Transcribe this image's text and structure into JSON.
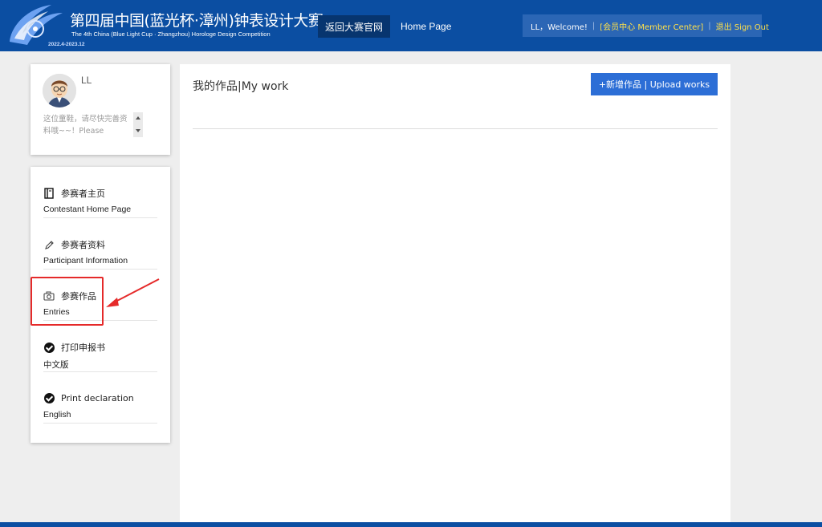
{
  "header": {
    "logo_title": "第四届中国(蓝光杯·漳州)钟表设计大赛",
    "logo_subtitle": "The 4th China (Blue Light Cup · Zhangzhou) Horologe Design Competition",
    "logo_date": "2022.4-2023.12",
    "nav_back": "返回大赛官网",
    "nav_home": "Home Page",
    "user_welcome": "LL，Welcome!",
    "member_center": "[会员中心 Member Center]",
    "sign_out": "退出 Sign Out"
  },
  "profile": {
    "name": "LL",
    "message": "这位童鞋，请尽快完善资料哦~~！Please"
  },
  "menu": {
    "items": [
      {
        "icon": "book-icon",
        "zh": "参赛者主页",
        "en": "Contestant Home Page"
      },
      {
        "icon": "pencil-icon",
        "zh": "参赛者资料",
        "en": "Participant Information"
      },
      {
        "icon": "camera-icon",
        "zh": "参赛作品",
        "en": "Entries"
      },
      {
        "icon": "check-circle-icon",
        "zh": "打印申报书",
        "en": "中文版"
      },
      {
        "icon": "check-circle-icon",
        "zh": "Print declaration",
        "en": "English"
      }
    ]
  },
  "main": {
    "title": "我的作品|My work",
    "upload_button": "+新增作品 | Upload works"
  },
  "colors": {
    "header_bg": "#0b4ea2",
    "accent_button": "#2c6ed6",
    "highlight_red": "#e52a2a",
    "member_yellow": "#ffe04a"
  }
}
